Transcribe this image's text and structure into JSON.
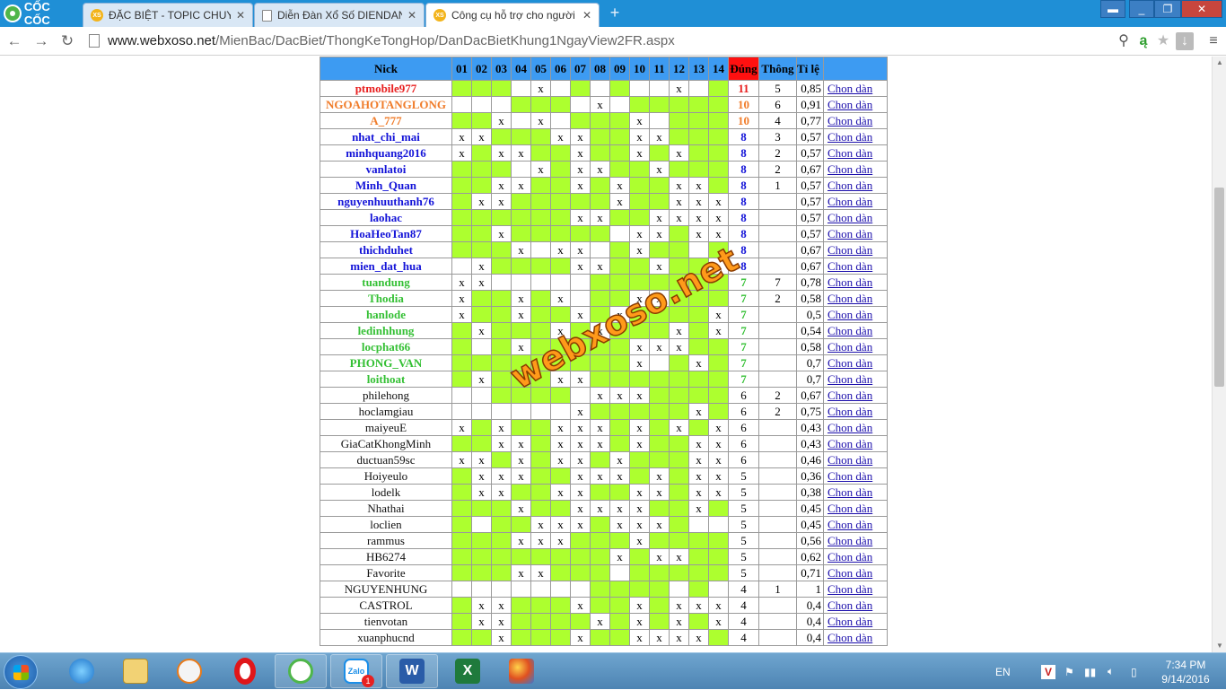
{
  "browser": {
    "brand": "CỐC CỐC",
    "tabs": [
      {
        "title": "ĐẶC BIỆT - TOPIC CHUYÊN",
        "favicon": "xs-icon"
      },
      {
        "title": "Diễn Đàn Xổ Số DIENDAN",
        "favicon": "document-icon"
      },
      {
        "title": "Công cụ hỗ trợ cho người",
        "favicon": "xs-icon",
        "active": true
      }
    ],
    "url_host": "www.webxoso.net",
    "url_path": "/MienBac/DacBiet/ThongKeTongHop/DanDacBietKhung1NgayView2FR.aspx"
  },
  "table": {
    "headers": {
      "nick": "Nick",
      "days": [
        "01",
        "02",
        "03",
        "04",
        "05",
        "06",
        "07",
        "08",
        "09",
        "10",
        "11",
        "12",
        "13",
        "14"
      ],
      "dung": "Đúng",
      "thong": "Thông",
      "tile": "Tỉ lệ"
    },
    "link_label": "Chon dàn",
    "rows": [
      {
        "nick": "ptmobile977",
        "color": "red",
        "days": "ggg x g g  x ggggg",
        "dung": "11",
        "thong": "5",
        "tile": "0,85"
      },
      {
        "nick": "NGOAHOTANGLONG",
        "color": "orange",
        "days": "   ggg x gggggg",
        "dung": "10",
        "thong": "6",
        "tile": "0,91"
      },
      {
        "nick": "A_777",
        "color": "orange",
        "days": "ggx x gggx gggg",
        "dung": "10",
        "thong": "4",
        "tile": "0,77"
      },
      {
        "nick": "nhat_chi_mai",
        "color": "blue",
        "days": "xxgggxxggxxggg",
        "dung": "8",
        "thong": "3",
        "tile": "0,57"
      },
      {
        "nick": "minhquang2016",
        "color": "blue",
        "days": "xgxxggxggxgxgg",
        "dung": "8",
        "thong": "2",
        "tile": "0,57"
      },
      {
        "nick": "vanlatoi",
        "color": "blue",
        "days": "ggg xgxxggxggg",
        "dung": "8",
        "thong": "2",
        "tile": "0,67"
      },
      {
        "nick": "Minh_Quan",
        "color": "blue",
        "days": "ggxxggxgxggxxg",
        "dung": "8",
        "thong": "1",
        "tile": "0,57"
      },
      {
        "nick": "nguyenhuuthanh76",
        "color": "blue",
        "days": "gxxgggggxggxxx",
        "dung": "8",
        "thong": "",
        "tile": "0,57"
      },
      {
        "nick": "laohac",
        "color": "blue",
        "days": "ggggggxxggxxxx",
        "dung": "8",
        "thong": "",
        "tile": "0,57"
      },
      {
        "nick": "HoaHeoTan87",
        "color": "blue",
        "days": "ggxggggg xxgxx",
        "dung": "8",
        "thong": "",
        "tile": "0,57"
      },
      {
        "nick": "thichduhet",
        "color": "blue",
        "days": "gggx xx gxgg g",
        "dung": "8",
        "thong": "",
        "tile": "0,67"
      },
      {
        "nick": "mien_dat_hua",
        "color": "blue",
        "days": " xggggxxggxgg ",
        "dung": "8",
        "thong": "",
        "tile": "0,67"
      },
      {
        "nick": "tuandung",
        "color": "green",
        "days": "xx     ggggggg",
        "dung": "7",
        "thong": "7",
        "tile": "0,78"
      },
      {
        "nick": "Thodia",
        "color": "green",
        "days": "xggxgx ggxxggg",
        "dung": "7",
        "thong": "2",
        "tile": "0,58"
      },
      {
        "nick": "hanlode",
        "color": "green",
        "days": "xggxggxgxggggx",
        "dung": "7",
        "thong": "",
        "tile": "0,5"
      },
      {
        "nick": "ledinhhung",
        "color": "green",
        "days": "gxgggxgxgggxgx",
        "dung": "7",
        "thong": "",
        "tile": "0,54"
      },
      {
        "nick": "locphat66",
        "color": "green",
        "days": "g gxgggggxxxgg",
        "dung": "7",
        "thong": "",
        "tile": "0,58"
      },
      {
        "nick": "PHONG_VAN",
        "color": "green",
        "days": "gggggggggx gxg",
        "dung": "7",
        "thong": "",
        "tile": "0,7"
      },
      {
        "nick": "loithoat",
        "color": "green",
        "days": "gxgggxxggggggg",
        "dung": "7",
        "thong": "",
        "tile": "0,7"
      },
      {
        "nick": "philehong",
        "color": "plain",
        "days": "  gggg xxxgggg",
        "dung": "6",
        "thong": "2",
        "tile": "0,67"
      },
      {
        "nick": "hoclamgiau",
        "color": "plain",
        "days": "      xgggggxgg",
        "dung": "6",
        "thong": "2",
        "tile": "0,75"
      },
      {
        "nick": "maiyeuE",
        "color": "plain",
        "days": "xgxggxxxgxgxgx",
        "dung": "6",
        "thong": "",
        "tile": "0,43"
      },
      {
        "nick": "GiaCatKhongMinh",
        "color": "plain",
        "days": "ggxxgxxxgxggxx",
        "dung": "6",
        "thong": "",
        "tile": "0,43"
      },
      {
        "nick": "ductuan59sc",
        "color": "plain",
        "days": "xxgxgxxgxgggxx",
        "dung": "6",
        "thong": "",
        "tile": "0,46"
      },
      {
        "nick": "Hoiyeulo",
        "color": "plain",
        "days": "gxxxggxxxgxgxx",
        "dung": "5",
        "thong": "",
        "tile": "0,36"
      },
      {
        "nick": "lodelk",
        "color": "plain",
        "days": "gxxggxxggxxgxx",
        "dung": "5",
        "thong": "",
        "tile": "0,38"
      },
      {
        "nick": "Nhathai",
        "color": "plain",
        "days": "gggxggxxxxggxg",
        "dung": "5",
        "thong": "",
        "tile": "0,45"
      },
      {
        "nick": "loclien",
        "color": "plain",
        "days": "g ggxxxgxxxg  ",
        "dung": "5",
        "thong": "",
        "tile": "0,45"
      },
      {
        "nick": "rammus",
        "color": "plain",
        "days": "gggxxxgggxgggg",
        "dung": "5",
        "thong": "",
        "tile": "0,56"
      },
      {
        "nick": "HB6274",
        "color": "plain",
        "days": "ggggggggxgxxgg",
        "dung": "5",
        "thong": "",
        "tile": "0,62"
      },
      {
        "nick": "Favorite",
        "color": "plain",
        "days": "gggxxggg ggggg",
        "dung": "5",
        "thong": "",
        "tile": "0,71"
      },
      {
        "nick": "NGUYENHUNG",
        "color": "plain",
        "days": "       gggg g g",
        "dung": "4",
        "thong": "1",
        "tile": "1"
      },
      {
        "nick": "CASTROL",
        "color": "plain",
        "days": "gxxgggxggxgxxx",
        "dung": "4",
        "thong": "",
        "tile": "0,4"
      },
      {
        "nick": "tienvotan",
        "color": "plain",
        "days": "gxxggggxgxgxgx",
        "dung": "4",
        "thong": "",
        "tile": "0,4"
      },
      {
        "nick": "xuanphucnd",
        "color": "plain",
        "days": "ggxgggxggxxxxg",
        "dung": "4",
        "thong": "",
        "tile": "0,4"
      }
    ]
  },
  "watermark": "webxoso.net",
  "taskbar": {
    "language": "EN",
    "time": "7:34 PM",
    "date": "9/14/2016",
    "zalo_badge": "1"
  }
}
